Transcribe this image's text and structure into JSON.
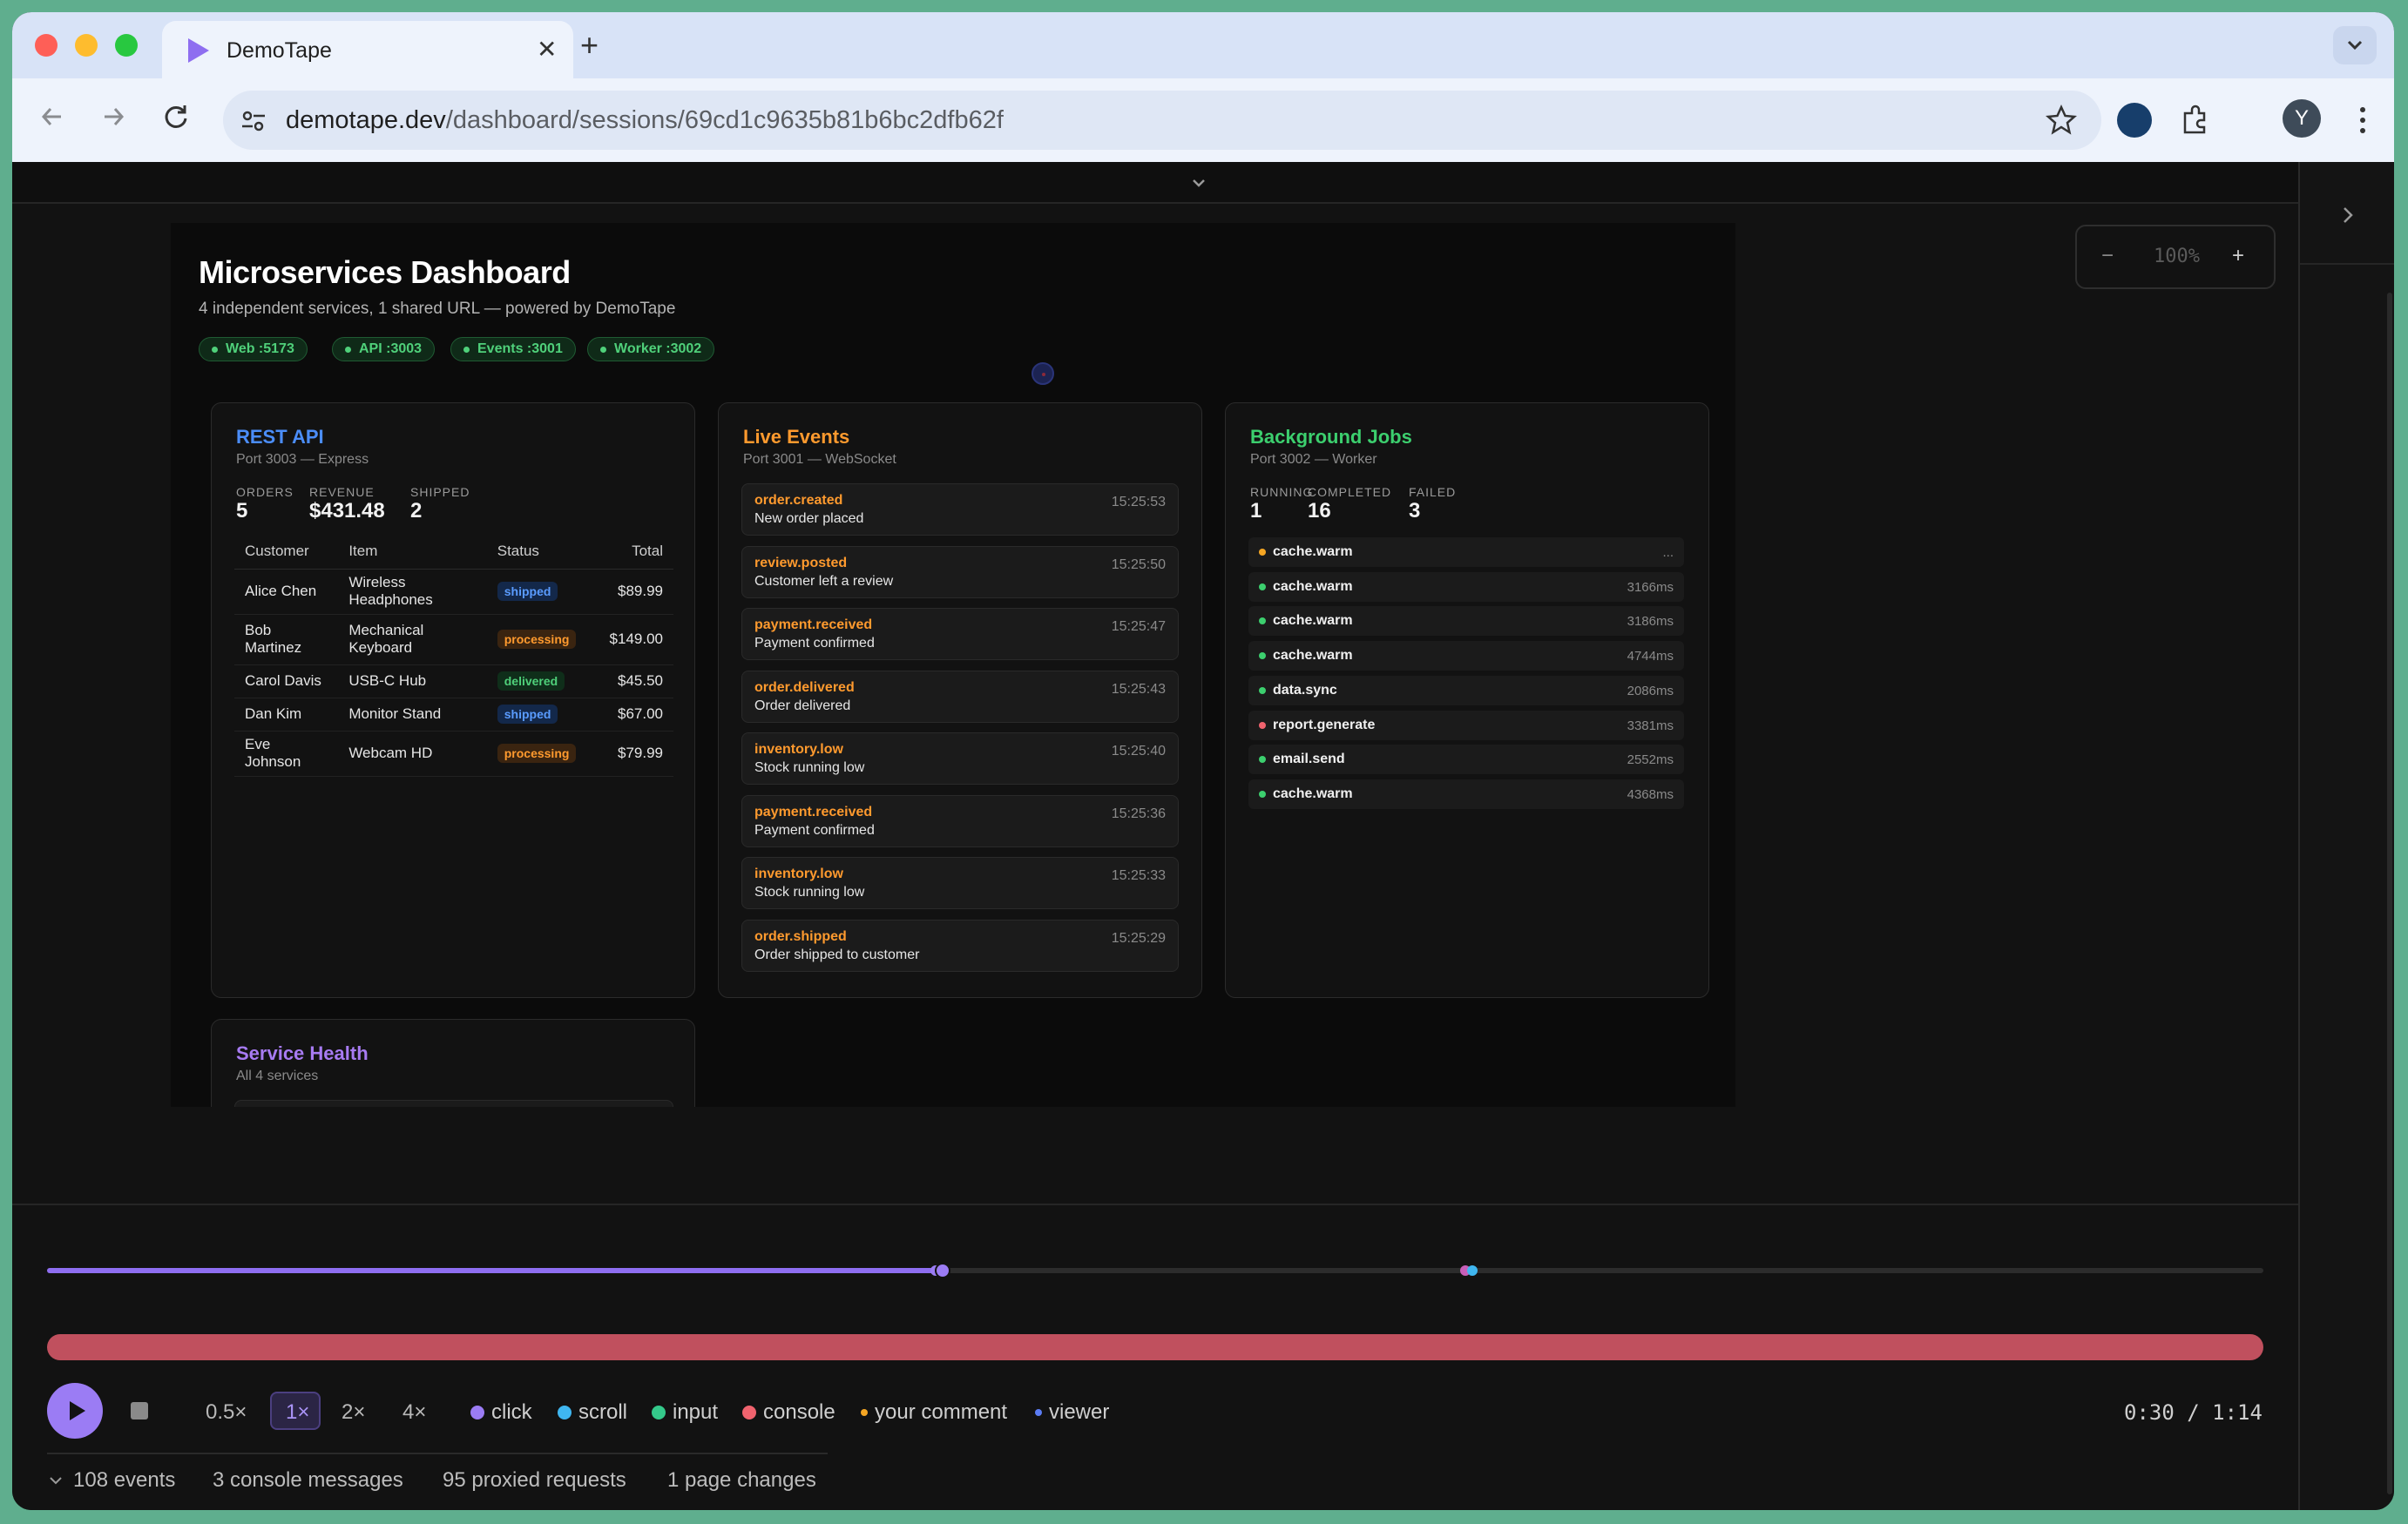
{
  "browser": {
    "tab_title": "DemoTape",
    "tab_close": "✕",
    "new_tab": "+",
    "url_host": "demotape.dev",
    "url_path": "/dashboard/sessions/69cd1c9635b81b6bc2dfb62f",
    "profile_initial": "Y"
  },
  "dashboard": {
    "title": "Microservices Dashboard",
    "subtitle": "4 independent services, 1 shared URL — powered by DemoTape",
    "service_pills": [
      "Web :5173",
      "API :3003",
      "Events :3001",
      "Worker :3002"
    ],
    "rest_api": {
      "title": "REST API",
      "subtitle": "Port 3003 — Express",
      "stats": [
        {
          "label": "ORDERS",
          "value": "5"
        },
        {
          "label": "REVENUE",
          "value": "$431.48"
        },
        {
          "label": "SHIPPED",
          "value": "2"
        }
      ],
      "columns": [
        "Customer",
        "Item",
        "Status",
        "Total"
      ],
      "rows": [
        {
          "customer": "Alice Chen",
          "item": "Wireless Headphones",
          "status": "shipped",
          "total": "$89.99"
        },
        {
          "customer": "Bob Martinez",
          "item": "Mechanical Keyboard",
          "status": "processing",
          "total": "$149.00"
        },
        {
          "customer": "Carol Davis",
          "item": "USB-C Hub",
          "status": "delivered",
          "total": "$45.50"
        },
        {
          "customer": "Dan Kim",
          "item": "Monitor Stand",
          "status": "shipped",
          "total": "$67.00"
        },
        {
          "customer": "Eve Johnson",
          "item": "Webcam HD",
          "status": "processing",
          "total": "$79.99"
        }
      ]
    },
    "live_events": {
      "title": "Live Events",
      "subtitle": "Port 3001 — WebSocket",
      "events": [
        {
          "name": "order.created",
          "desc": "New order placed",
          "time": "15:25:53"
        },
        {
          "name": "review.posted",
          "desc": "Customer left a review",
          "time": "15:25:50"
        },
        {
          "name": "payment.received",
          "desc": "Payment confirmed",
          "time": "15:25:47"
        },
        {
          "name": "order.delivered",
          "desc": "Order delivered",
          "time": "15:25:43"
        },
        {
          "name": "inventory.low",
          "desc": "Stock running low",
          "time": "15:25:40"
        },
        {
          "name": "payment.received",
          "desc": "Payment confirmed",
          "time": "15:25:36"
        },
        {
          "name": "inventory.low",
          "desc": "Stock running low",
          "time": "15:25:33"
        },
        {
          "name": "order.shipped",
          "desc": "Order shipped to customer",
          "time": "15:25:29"
        }
      ]
    },
    "background_jobs": {
      "title": "Background Jobs",
      "subtitle": "Port 3002 — Worker",
      "stats": [
        {
          "label": "RUNNING",
          "value": "1"
        },
        {
          "label": "COMPLETED",
          "value": "16"
        },
        {
          "label": "FAILED",
          "value": "3"
        }
      ],
      "jobs": [
        {
          "name": "cache.warm",
          "time": "...",
          "state": "running"
        },
        {
          "name": "cache.warm",
          "time": "3166ms",
          "state": "done"
        },
        {
          "name": "cache.warm",
          "time": "3186ms",
          "state": "done"
        },
        {
          "name": "cache.warm",
          "time": "4744ms",
          "state": "done"
        },
        {
          "name": "data.sync",
          "time": "2086ms",
          "state": "done"
        },
        {
          "name": "report.generate",
          "time": "3381ms",
          "state": "failed"
        },
        {
          "name": "email.send",
          "time": "2552ms",
          "state": "done"
        },
        {
          "name": "cache.warm",
          "time": "4368ms",
          "state": "done"
        }
      ]
    },
    "service_health": {
      "title": "Service Health",
      "subtitle": "All 4 services"
    }
  },
  "zoom": {
    "minus": "−",
    "value": "100%",
    "plus": "+"
  },
  "player": {
    "progress_fraction": 0.404,
    "speeds": [
      "0.5×",
      "1×",
      "2×",
      "4×"
    ],
    "active_speed": "1×",
    "legend": [
      {
        "label": "click",
        "color": "#9b7cf4"
      },
      {
        "label": "scroll",
        "color": "#3fb6f0"
      },
      {
        "label": "input",
        "color": "#34c98a"
      },
      {
        "label": "console",
        "color": "#f0636e"
      },
      {
        "label": "your comment",
        "color": "#f5a623"
      },
      {
        "label": "viewer",
        "color": "#5b7cf4"
      }
    ],
    "time_current": "0:30",
    "time_separator": "/",
    "time_total": "1:14",
    "footer": {
      "events": "108 events",
      "console": "3 console messages",
      "requests": "95 proxied requests",
      "pages": "1 page changes"
    }
  },
  "colors": {
    "accent": "#8e6ef0",
    "rest_title": "#4b8df8",
    "events_title": "#ff9a2e",
    "jobs_title": "#3ccf6e",
    "health_title": "#a77bf2",
    "console_bar": "#c0505e"
  }
}
